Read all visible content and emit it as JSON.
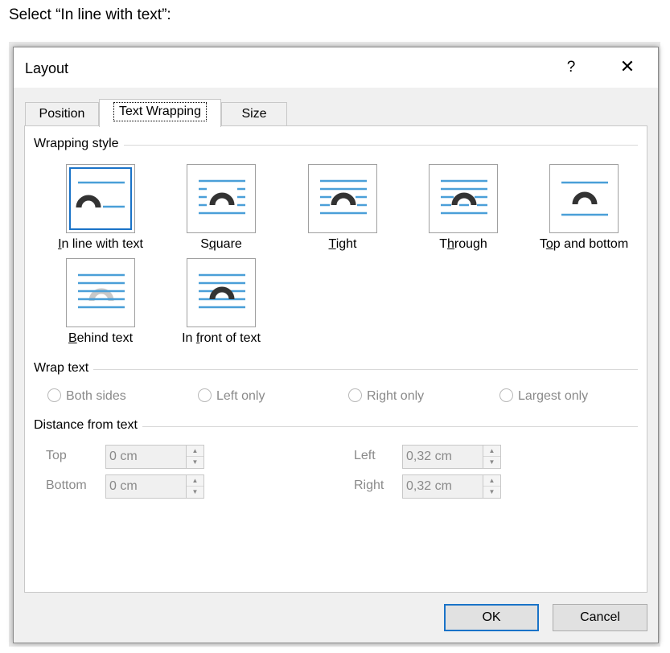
{
  "instruction": "Select “In line with text”:",
  "dialog": {
    "title": "Layout",
    "help": "?",
    "close": "✕"
  },
  "tabs": [
    {
      "label": "Position"
    },
    {
      "label": "Text Wrapping"
    },
    {
      "label": "Size"
    }
  ],
  "wrapping_style": {
    "label": "Wrapping style",
    "styles": [
      {
        "pre": "",
        "key": "I",
        "post": "n line with text"
      },
      {
        "pre": "S",
        "key": "q",
        "post": "uare"
      },
      {
        "pre": "",
        "key": "T",
        "post": "ight"
      },
      {
        "pre": "T",
        "key": "h",
        "post": "rough"
      },
      {
        "pre": "T",
        "key": "o",
        "post": "p and bottom"
      },
      {
        "pre": "",
        "key": "B",
        "post": "ehind text"
      },
      {
        "pre": "In ",
        "key": "f",
        "post": "ront of text"
      }
    ]
  },
  "wrap_text": {
    "label": "Wrap text",
    "options": [
      "Both sides",
      "Left only",
      "Right only",
      "Largest only"
    ]
  },
  "distance": {
    "label": "Distance from text",
    "top_label": "Top",
    "top_value": "0 cm",
    "bottom_label": "Bottom",
    "bottom_value": "0 cm",
    "left_label": "Left",
    "left_value": "0,32 cm",
    "right_label": "Right",
    "right_value": "0,32 cm"
  },
  "buttons": {
    "ok": "OK",
    "cancel": "Cancel"
  },
  "colors": {
    "accent": "#1a73c8",
    "line": "#4a9fd8",
    "arc": "#333333",
    "arc_behind": "#c8c8c8"
  },
  "icons": {
    "help": "question-mark-icon",
    "close": "close-icon",
    "spin_up": "triangle-up-icon",
    "spin_down": "triangle-down-icon"
  }
}
